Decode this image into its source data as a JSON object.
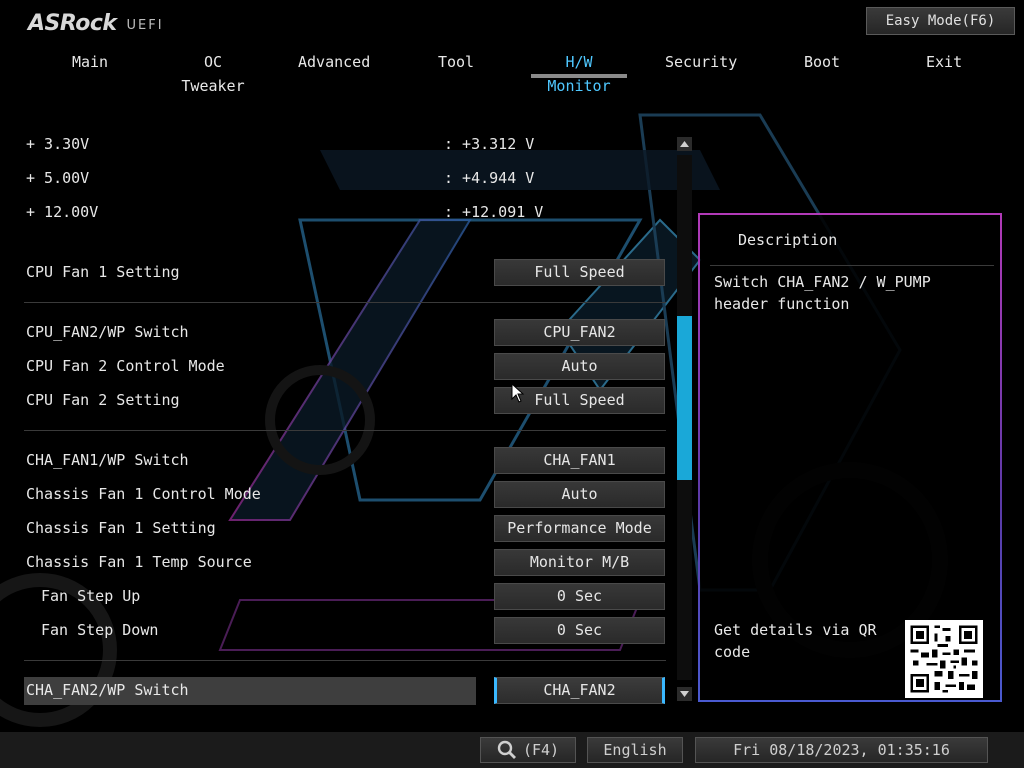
{
  "header": {
    "brand": "ASRock",
    "brand_sub": "UEFI",
    "easy_mode": "Easy Mode(F6)"
  },
  "tabs": [
    {
      "label": "Main"
    },
    {
      "label": "OC Tweaker"
    },
    {
      "label": "Advanced"
    },
    {
      "label": "Tool"
    },
    {
      "label": "H/W Monitor",
      "active": true
    },
    {
      "label": "Security"
    },
    {
      "label": "Boot"
    },
    {
      "label": "Exit"
    }
  ],
  "voltages": [
    {
      "label": "+ 3.30V",
      "value": ": +3.312 V"
    },
    {
      "label": "+ 5.00V",
      "value": ": +4.944 V"
    },
    {
      "label": "+ 12.00V",
      "value": ": +12.091 V"
    }
  ],
  "settings": [
    {
      "label": "CPU Fan 1 Setting",
      "value": "Full Speed"
    },
    {
      "label": "CPU_FAN2/WP Switch",
      "value": "CPU_FAN2"
    },
    {
      "label": "CPU Fan 2 Control Mode",
      "value": "Auto"
    },
    {
      "label": "CPU Fan 2 Setting",
      "value": "Full Speed"
    },
    {
      "label": "CHA_FAN1/WP Switch",
      "value": "CHA_FAN1"
    },
    {
      "label": "Chassis Fan 1 Control Mode",
      "value": "Auto"
    },
    {
      "label": "Chassis Fan 1 Setting",
      "value": "Performance Mode"
    },
    {
      "label": "Chassis Fan 1 Temp Source",
      "value": "Monitor M/B"
    },
    {
      "label": "Fan Step Up",
      "value": "0 Sec"
    },
    {
      "label": "Fan Step Down",
      "value": "0 Sec"
    },
    {
      "label": "CHA_FAN2/WP Switch",
      "value": "CHA_FAN2",
      "selected": true
    }
  ],
  "description": {
    "title": "Description",
    "text": "Switch CHA_FAN2 / W_PUMP header function",
    "qr_text": "Get details via QR code"
  },
  "footer": {
    "search_key": "(F4)",
    "language": "English",
    "datetime": "Fri 08/18/2023, 01:35:16"
  },
  "colors": {
    "accent": "#4fc8ff",
    "scrollbar": "#1aa8d8",
    "panel_border": "#b23ab8"
  }
}
